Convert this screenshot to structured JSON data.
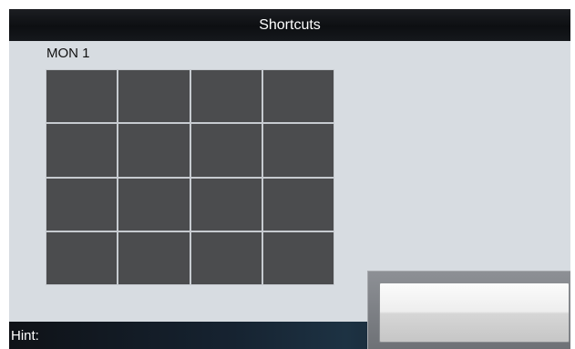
{
  "header": {
    "title": "Shortcuts"
  },
  "monitor": {
    "label": "MON 1",
    "layout": {
      "rows": 4,
      "columns": 4
    }
  },
  "hint": {
    "label": "Hint:"
  },
  "action_button": {
    "label": ""
  },
  "colors": {
    "title_bar": "#0d0f12",
    "background": "#d7dce1",
    "grid_cell": "#4b4c4e",
    "grid_line": "#c7cbd0"
  }
}
